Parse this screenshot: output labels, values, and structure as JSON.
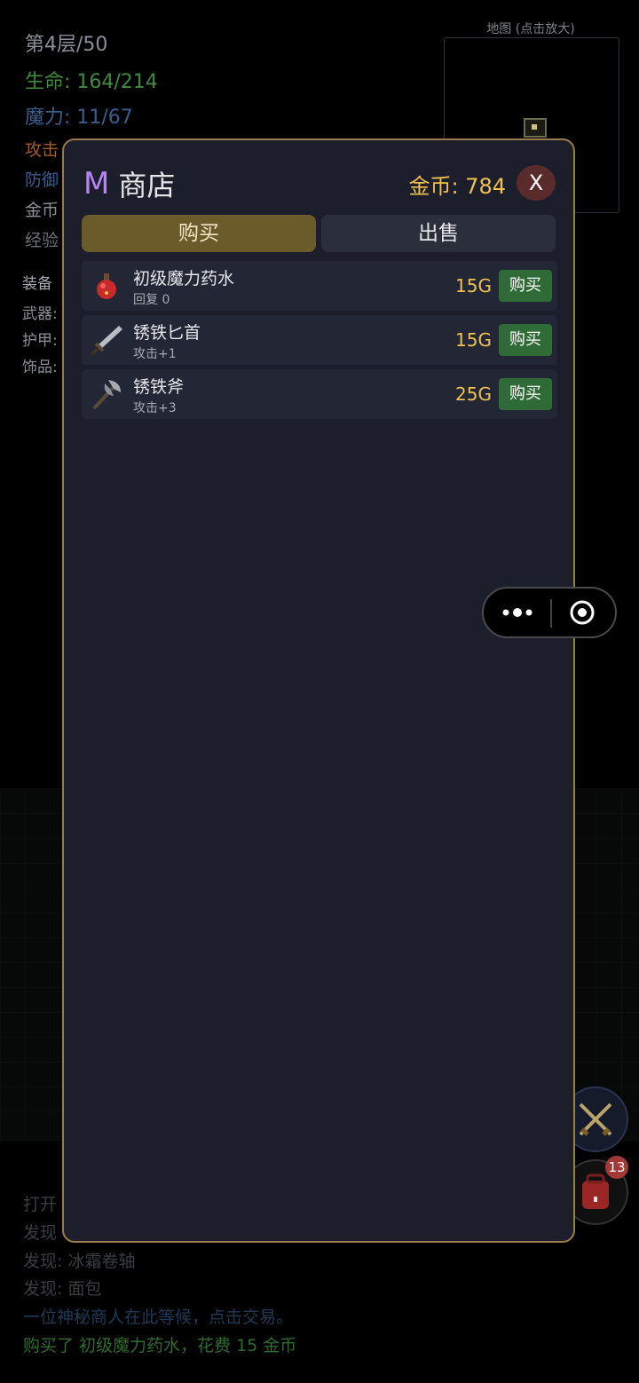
{
  "hud": {
    "floor": "第4层/50",
    "hp": "生命: 164/214",
    "mp": "魔力: 11/67",
    "attack_prefix": "攻击",
    "defense_prefix": "防御",
    "gold_prefix": "金币",
    "exp_prefix": "经验",
    "equip_header": "装备",
    "weapon_prefix": "武器:",
    "armor_prefix": "护甲:",
    "accessory_prefix": "饰品:"
  },
  "map": {
    "label": "地图 (点击放大)"
  },
  "shop": {
    "logo": "M",
    "title": "商店",
    "gold": "金币: 784",
    "close": "X",
    "tabs": [
      {
        "label": "购买",
        "active": true
      },
      {
        "label": "出售",
        "active": false
      }
    ],
    "items": [
      {
        "name": "初级魔力药水",
        "desc": "回复 0",
        "price": "15G",
        "buy": "购买",
        "icon": "potion-icon"
      },
      {
        "name": "锈铁匕首",
        "desc": "攻击+1",
        "price": "15G",
        "buy": "购买",
        "icon": "dagger-icon"
      },
      {
        "name": "锈铁斧",
        "desc": "攻击+3",
        "price": "25G",
        "buy": "购买",
        "icon": "axe-icon"
      }
    ]
  },
  "log": [
    {
      "text": "打开",
      "color": "#3a3d42"
    },
    {
      "text": "发现",
      "color": "#3a3d42"
    },
    {
      "text": "发现: 冰霜卷轴",
      "color": "#3a3d42"
    },
    {
      "text": "发现: 面包",
      "color": "#3a3d42"
    },
    {
      "text": "一位神秘商人在此等候，点击交易。",
      "color": "#1f3a57"
    },
    {
      "text": "购买了 初级魔力药水，花费 15 金币",
      "color": "#2f6b2f"
    }
  ],
  "side": {
    "bag_badge": "13"
  },
  "colors": {
    "accent_gold": "#f0c050",
    "buy_green": "#2f6b36",
    "frame": "#9b7b4c",
    "hp_green": "#3f8a3f",
    "mp_blue": "#3b5d8c"
  }
}
